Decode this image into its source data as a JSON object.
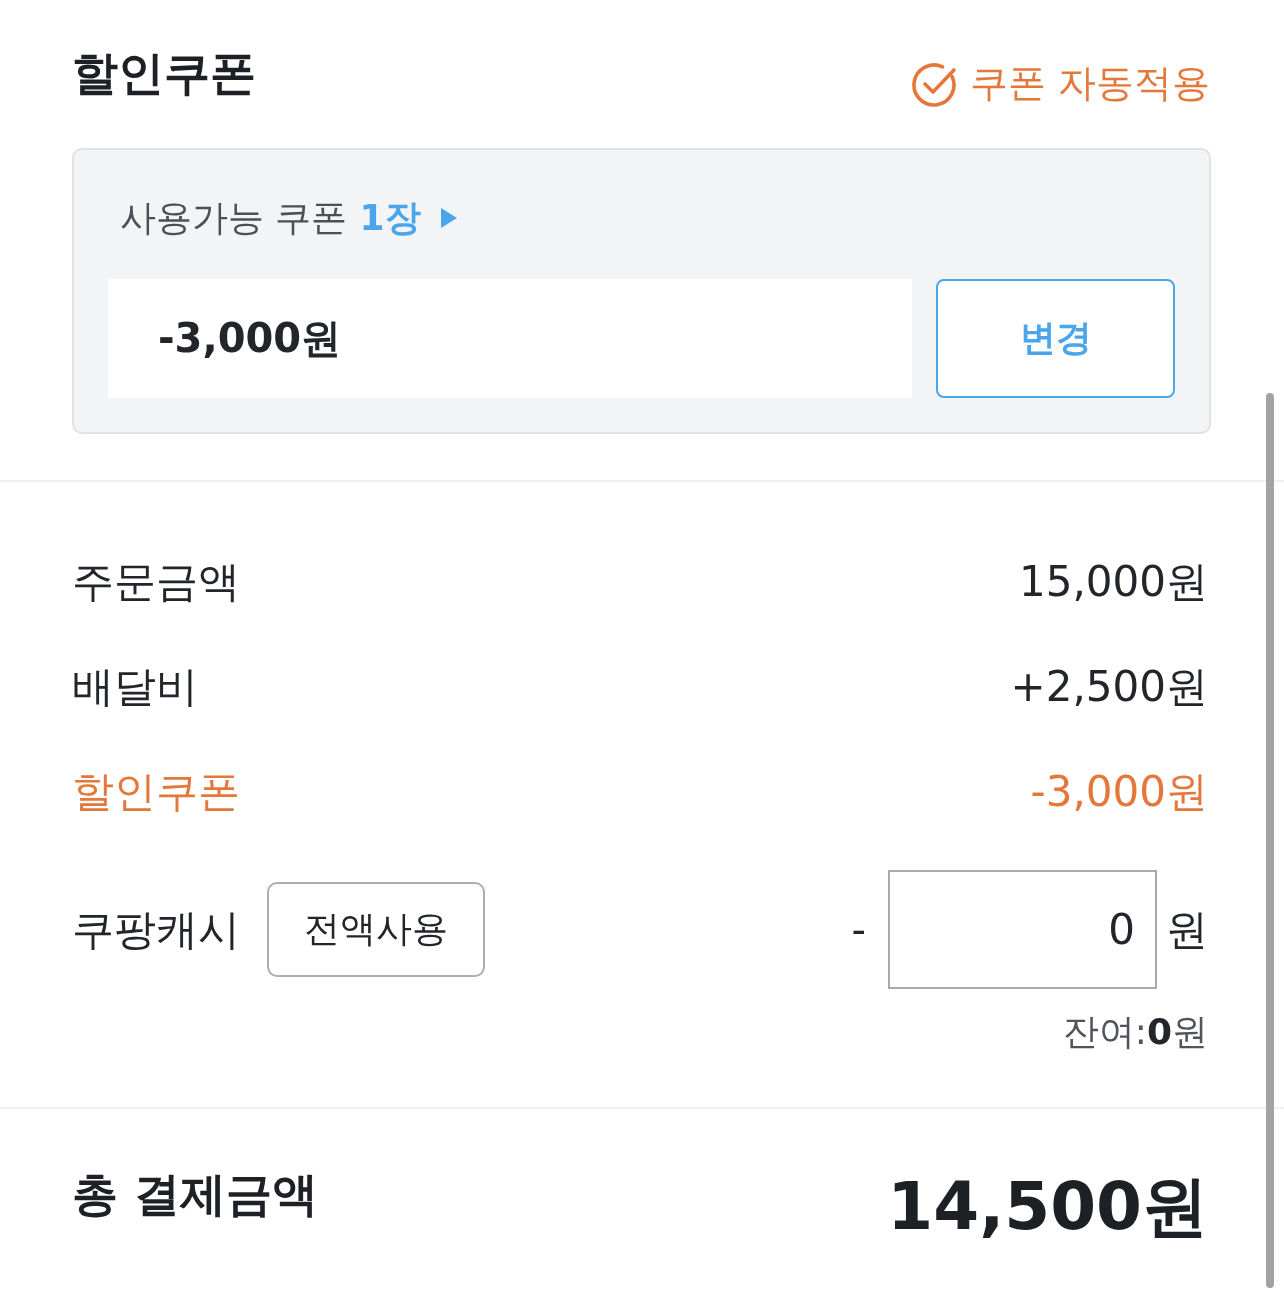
{
  "header": {
    "title": "할인쿠폰",
    "auto_apply": "쿠폰 자동적용"
  },
  "coupon_panel": {
    "available_label": "사용가능 쿠폰",
    "available_count": "1장",
    "applied_value": "-3,000원",
    "change_button": "변경"
  },
  "summary_rows": [
    {
      "kind": "plain",
      "label": "주문금액",
      "value": "15,000원"
    },
    {
      "kind": "plain",
      "label": "배달비",
      "value": "+2,500원"
    },
    {
      "kind": "discount",
      "label": "할인쿠폰",
      "value": "-3,000원"
    }
  ],
  "cash": {
    "label": "쿠팡캐시",
    "use_all_button": "전액사용",
    "sign": "-",
    "value": "0",
    "unit": "원",
    "balance": "잔여:**0**원"
  },
  "total": {
    "label": "총 결제금액",
    "value": "14,500원"
  }
}
